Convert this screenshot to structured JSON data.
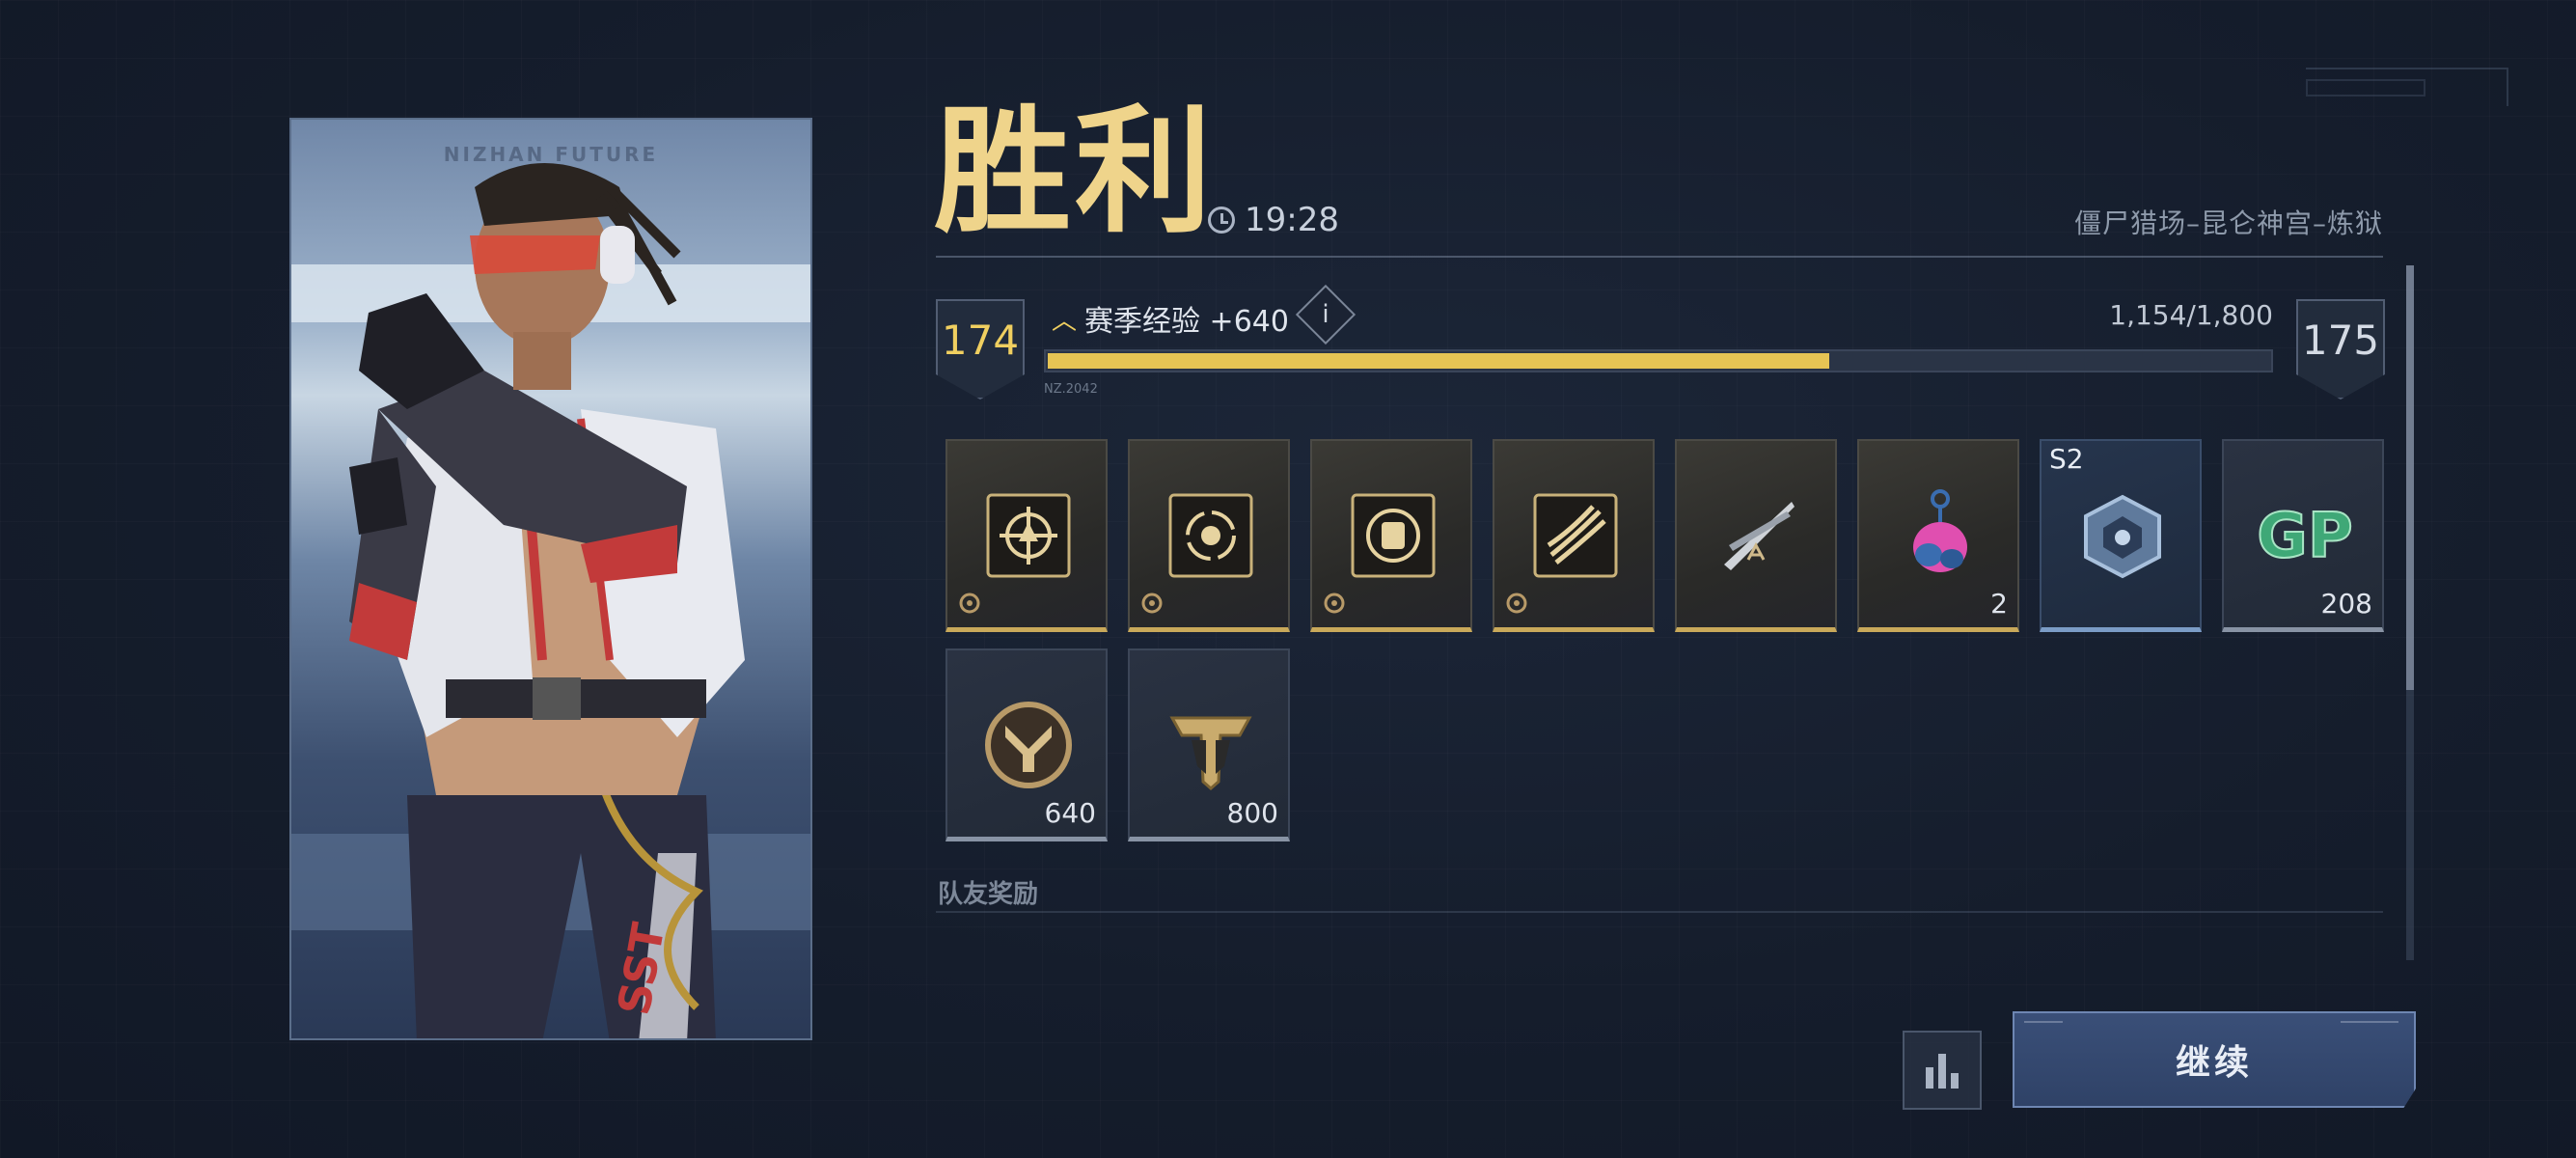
{
  "character": {
    "brand_text": "NIZHAN FUTURE",
    "image": "character-portrait"
  },
  "header": {
    "result": "胜利",
    "time": "19:28",
    "mode": "僵尸猎场–昆仑神宫–炼狱"
  },
  "progress": {
    "current_level": "174",
    "next_level": "175",
    "xp_label": "赛季经验 +640",
    "info": "i",
    "xp_count": "1,154/1,800",
    "xp_fraction": 0.641,
    "tag": "NZ.2042"
  },
  "rewards": [
    {
      "icon": "crosshair-talent-icon",
      "style": "gold",
      "count": ""
    },
    {
      "icon": "cycle-talent-icon",
      "style": "gold",
      "count": ""
    },
    {
      "icon": "fist-talent-icon",
      "style": "gold",
      "count": ""
    },
    {
      "icon": "claw-talent-icon",
      "style": "gold",
      "count": ""
    },
    {
      "icon": "dual-blade-weapon-icon",
      "style": "gold",
      "count": ""
    },
    {
      "icon": "pink-charm-icon",
      "style": "gold",
      "count": "2"
    },
    {
      "icon": "s2-crate-icon",
      "style": "blue",
      "count": "",
      "season": "S2"
    },
    {
      "icon": "gp-currency-icon",
      "style": "gray",
      "count": "208",
      "text": "GP"
    },
    {
      "icon": "y-coin-icon",
      "style": "gray",
      "count": "640"
    },
    {
      "icon": "t-emblem-icon",
      "style": "gray",
      "count": "800"
    }
  ],
  "team_rewards_label": "队友奖励",
  "buttons": {
    "continue": "继续",
    "stats": "stats"
  },
  "colors": {
    "gold": "#efd48b",
    "xp_fill": "#e6c454",
    "accent_blue": "#3a4f78"
  }
}
